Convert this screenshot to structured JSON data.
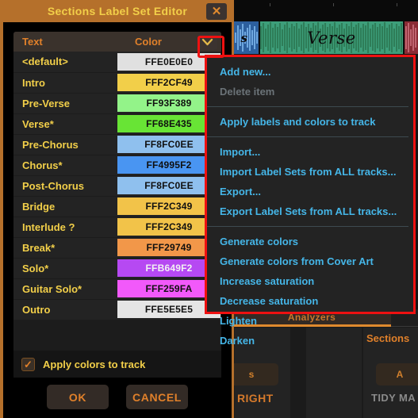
{
  "dialog": {
    "title": "Sections Label Set Editor",
    "close_icon": "close-icon",
    "table": {
      "headers": {
        "text": "Text",
        "color": "Color"
      },
      "chevron_icon": "chevron-down-icon",
      "rows": [
        {
          "text": "<default>",
          "color_code": "FFE0E0E0",
          "swatch": "#e0e0e0",
          "fg": "#101010"
        },
        {
          "text": "Intro",
          "color_code": "FFF2CF49",
          "swatch": "#f2cf49",
          "fg": "#101010"
        },
        {
          "text": "Pre-Verse",
          "color_code": "FF93F389",
          "swatch": "#93f389",
          "fg": "#101010"
        },
        {
          "text": "Verse*",
          "color_code": "FF68E435",
          "swatch": "#68e435",
          "fg": "#101010"
        },
        {
          "text": "Pre-Chorus",
          "color_code": "FF8FC0EE",
          "swatch": "#8fc0ee",
          "fg": "#101010"
        },
        {
          "text": "Chorus*",
          "color_code": "FF4995F2",
          "swatch": "#4995f2",
          "fg": "#101010"
        },
        {
          "text": "Post-Chorus",
          "color_code": "FF8FC0EE",
          "swatch": "#8fc0ee",
          "fg": "#101010"
        },
        {
          "text": "Bridge",
          "color_code": "FFF2C349",
          "swatch": "#f2c349",
          "fg": "#101010"
        },
        {
          "text": "Interlude ?",
          "color_code": "FFF2C349",
          "swatch": "#f2c349",
          "fg": "#101010"
        },
        {
          "text": "Break*",
          "color_code": "FFF29749",
          "swatch": "#f29749",
          "fg": "#101010"
        },
        {
          "text": "Solo*",
          "color_code": "FFB649F2",
          "swatch": "#b649f2",
          "fg": "#f2f2f2"
        },
        {
          "text": "Guitar Solo*",
          "color_code": "FFF259FA",
          "swatch": "#f259fa",
          "fg": "#101010"
        },
        {
          "text": "Outro",
          "color_code": "FFE5E5E5",
          "swatch": "#e5e5e5",
          "fg": "#101010"
        }
      ]
    },
    "apply_checkbox": {
      "label": "Apply colors to track",
      "checked_mark": "✓"
    },
    "buttons": {
      "ok": "OK",
      "cancel": "CANCEL"
    }
  },
  "menu": {
    "items": [
      {
        "label": "Add new...",
        "disabled": false,
        "sep_after": false
      },
      {
        "label": "Delete item",
        "disabled": true,
        "sep_after": true
      },
      {
        "label": "Apply labels and colors to track",
        "disabled": false,
        "sep_after": true
      },
      {
        "label": "Import...",
        "disabled": false,
        "sep_after": false
      },
      {
        "label": "Import Label Sets from ALL tracks...",
        "disabled": false,
        "sep_after": false
      },
      {
        "label": "Export...",
        "disabled": false,
        "sep_after": false
      },
      {
        "label": "Export Label Sets from ALL tracks...",
        "disabled": false,
        "sep_after": true
      },
      {
        "label": "Generate colors",
        "disabled": false,
        "sep_after": false
      },
      {
        "label": "Generate colors from Cover Art",
        "disabled": false,
        "sep_after": false
      },
      {
        "label": "Increase saturation",
        "disabled": false,
        "sep_after": false
      },
      {
        "label": "Decrease saturation",
        "disabled": false,
        "sep_after": false
      },
      {
        "label": "Lighten",
        "disabled": false,
        "sep_after": false
      },
      {
        "label": "Darken",
        "disabled": false,
        "sep_after": false
      }
    ]
  },
  "background": {
    "clip_blue_label": "s",
    "clip_green_label": "Verse",
    "analyzers_label": "Analyzers",
    "sections_label": "Sections",
    "right_label": "RIGHT",
    "tidy_label": "TIDY MA",
    "mini_btn_left_label": "s",
    "mini_btn_right_label": "A"
  },
  "annotations": {
    "highlight_color": "#ee1111"
  }
}
